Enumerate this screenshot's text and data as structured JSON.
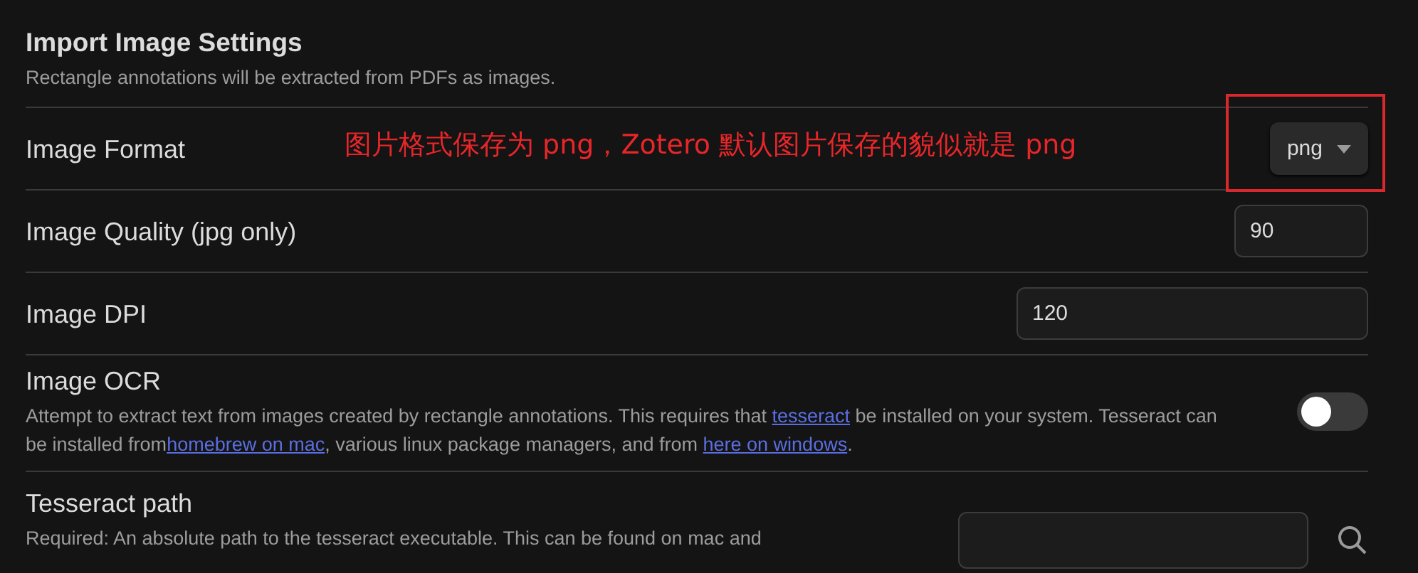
{
  "section": {
    "title": "Import Image Settings",
    "description": "Rectangle annotations will be extracted from PDFs as images."
  },
  "settings": [
    {
      "kind": "dropdown",
      "label": "Image Format",
      "value": "png"
    },
    {
      "kind": "number",
      "label": "Image Quality (jpg only)",
      "value": "90"
    },
    {
      "kind": "number",
      "label": "Image DPI",
      "value": "120"
    },
    {
      "kind": "toggle",
      "label": "Image OCR",
      "on": false,
      "description": [
        {
          "kind": "text",
          "text": "Attempt to extract text from images created by rectangle annotations. This requires that "
        },
        {
          "kind": "link",
          "text": "tesseract"
        },
        {
          "kind": "text",
          "text": " be installed on your system. Tesseract can be installed from"
        },
        {
          "kind": "link",
          "text": "homebrew on mac"
        },
        {
          "kind": "text",
          "text": ", various linux package managers, and from "
        },
        {
          "kind": "link",
          "text": "here on windows"
        },
        {
          "kind": "text",
          "text": "."
        }
      ]
    },
    {
      "kind": "path",
      "label": "Tesseract path",
      "description": [
        {
          "kind": "text",
          "text": "Required: An absolute path to the tesseract executable. This can be found on mac and"
        }
      ]
    }
  ],
  "annotation": {
    "text": "图片格式保存为 png，Zotero 默认图片保存的貌似就是 png"
  }
}
